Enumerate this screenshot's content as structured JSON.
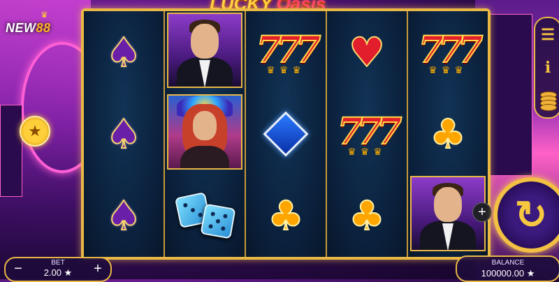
{
  "brand": {
    "logo_main": "NEW",
    "logo_accent": "88"
  },
  "game": {
    "title_main": "LUCKY",
    "title_sub": "Oasis"
  },
  "reels": [
    [
      "spade",
      "spade",
      "spade"
    ],
    [
      "gentleman",
      "showgirl",
      "dice"
    ],
    [
      "seven",
      "diamond",
      "club"
    ],
    [
      "heart",
      "seven",
      "club"
    ],
    [
      "seven",
      "club",
      "gentleman"
    ]
  ],
  "icons": {
    "star": "★",
    "menu": "☰",
    "info": "i",
    "spin": "↻",
    "plus": "+",
    "minus": "−"
  },
  "bet": {
    "label": "BET",
    "value": "2.00 ★"
  },
  "balance": {
    "label": "BALANCE",
    "value": "100000.00 ★"
  }
}
